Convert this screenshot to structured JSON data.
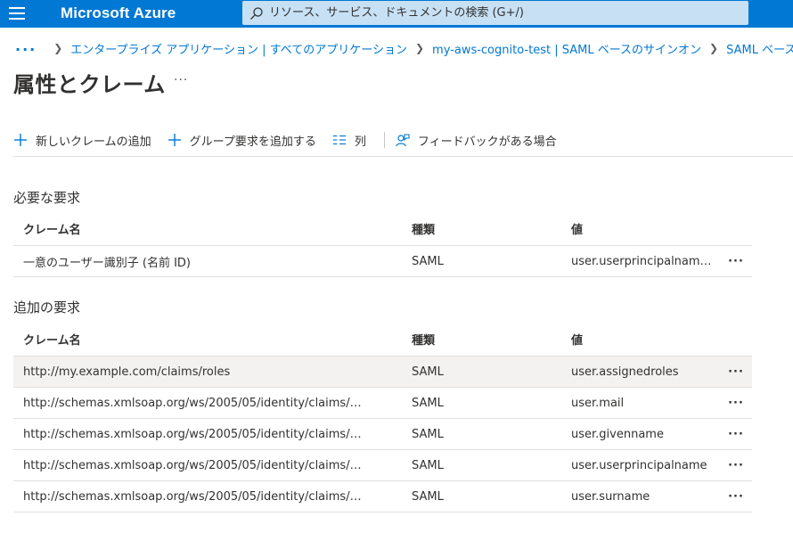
{
  "header": {
    "brand": "Microsoft Azure",
    "search_placeholder": "リソース、サービス、ドキュメントの検索 (G+/)"
  },
  "breadcrumb": {
    "ellipsis": "...",
    "items": [
      "エンタープライズ アプリケーション | すべてのアプリケーション",
      "my-aws-cognito-test | SAML ベースのサインオン",
      "SAML ベースのサ"
    ]
  },
  "page": {
    "title": "属性とクレーム",
    "more": "···"
  },
  "toolbar": {
    "add_claim": "新しいクレームの追加",
    "add_group_claim": "グループ要求を追加する",
    "columns": "列",
    "feedback": "フィードバックがある場合"
  },
  "required": {
    "title": "必要な要求",
    "headers": {
      "name": "クレーム名",
      "type": "種類",
      "value": "値"
    },
    "rows": [
      {
        "name": "一意のユーザー識別子 (名前 ID)",
        "type": "SAML",
        "value": "user.userprincipalnam…"
      }
    ]
  },
  "additional": {
    "title": "追加の要求",
    "headers": {
      "name": "クレーム名",
      "type": "種類",
      "value": "値"
    },
    "rows": [
      {
        "name": "http://my.example.com/claims/roles",
        "type": "SAML",
        "value": "user.assignedroles"
      },
      {
        "name": "http://schemas.xmlsoap.org/ws/2005/05/identity/claims/…",
        "type": "SAML",
        "value": "user.mail"
      },
      {
        "name": "http://schemas.xmlsoap.org/ws/2005/05/identity/claims/…",
        "type": "SAML",
        "value": "user.givenname"
      },
      {
        "name": "http://schemas.xmlsoap.org/ws/2005/05/identity/claims/…",
        "type": "SAML",
        "value": "user.userprincipalname"
      },
      {
        "name": "http://schemas.xmlsoap.org/ws/2005/05/identity/claims/…",
        "type": "SAML",
        "value": "user.surname"
      }
    ]
  },
  "row_more": "···",
  "colors": {
    "accent": "#0078d4",
    "search_bg": "#c7e0f4",
    "selected_row": "#f3f2f1"
  }
}
